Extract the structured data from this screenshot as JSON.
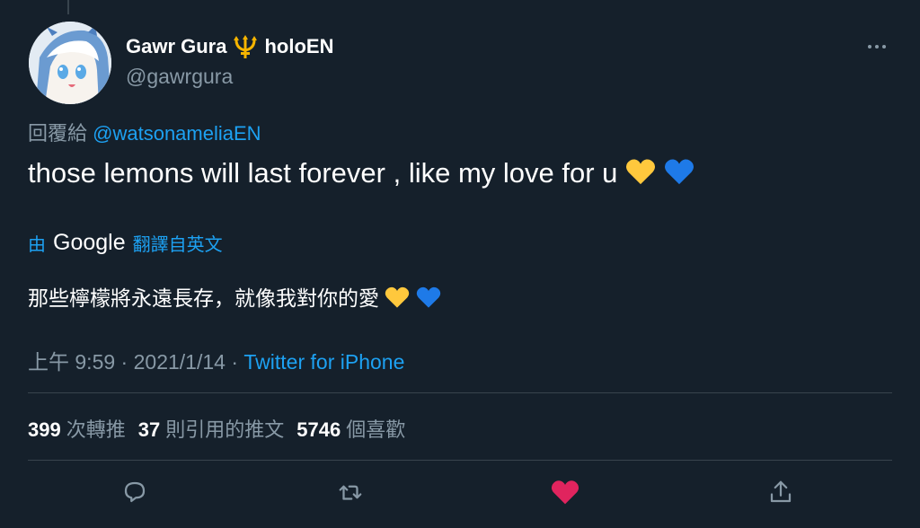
{
  "author": {
    "display_name": "Gawr Gura",
    "name_suffix": "holoEN",
    "handle": "@gawrgura",
    "badge_icon": "trident-icon",
    "badge_color": "#f5b400"
  },
  "reply": {
    "prefix": "回覆給",
    "mention": "@watsonameliaEN"
  },
  "tweet": {
    "text": "those lemons will last forever , like my love for u",
    "emojis": [
      "yellow-heart-icon",
      "blue-heart-icon"
    ]
  },
  "translation": {
    "by": "由",
    "provider": "Google",
    "label": "翻譯自英文",
    "text": "那些檸檬將永遠長存，就像我對你的愛"
  },
  "meta": {
    "time": "上午 9:59",
    "separator": "·",
    "date": "2021/1/14",
    "source": "Twitter for iPhone"
  },
  "stats": {
    "retweets": "399",
    "retweets_label": "次轉推",
    "quotes": "37",
    "quotes_label": "則引用的推文",
    "likes": "5746",
    "likes_label": "個喜歡"
  },
  "actions": {
    "reply_icon": "reply-icon",
    "retweet_icon": "retweet-icon",
    "like_icon": "heart-icon",
    "share_icon": "share-icon",
    "like_color": "#e0245e"
  },
  "colors": {
    "background": "#15202b",
    "accent": "#1da1f2",
    "muted": "#8899a6",
    "divider": "#38444d"
  }
}
